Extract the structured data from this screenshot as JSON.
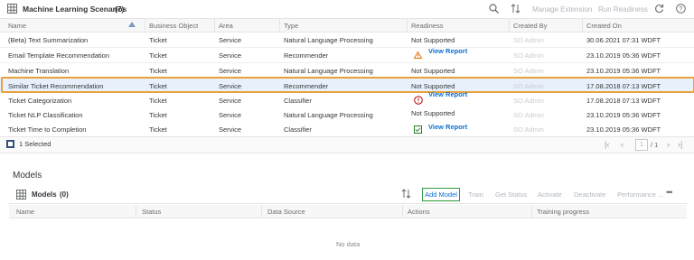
{
  "top_table": {
    "title": "Machine Learning Scenarios",
    "count": "(7)",
    "toolbar": {
      "manage_extension": "Manage Extension",
      "run_readiness": "Run Readiness"
    },
    "columns": [
      "Name",
      "Business Object",
      "Area",
      "Type",
      "Readiness",
      "Created By",
      "Created On"
    ],
    "rows": [
      {
        "name": "(Beta) Text Summarization",
        "bo": "Ticket",
        "area": "Service",
        "type": "Natural Language Processing",
        "readiness": "Not Supported",
        "created_by": "SO Admin",
        "created_on": "30.06.2021 07:31 WDFT"
      },
      {
        "name": "Email Template Recommendation",
        "bo": "Ticket",
        "area": "Service",
        "type": "Recommender",
        "readiness": "View Report",
        "created_by": "SO Admin",
        "created_on": "23.10.2019 05:36 WDFT"
      },
      {
        "name": "Machine Translation",
        "bo": "Ticket",
        "area": "Service",
        "type": "Natural Language Processing",
        "readiness": "Not Supported",
        "created_by": "SO Admin",
        "created_on": "23.10.2019 05:36 WDFT"
      },
      {
        "name": "Similar Ticket Recommendation",
        "bo": "Ticket",
        "area": "Service",
        "type": "Recommender",
        "readiness": "Not Supported",
        "created_by": "SO Admin",
        "created_on": "17.08.2018 07:13 WDFT"
      },
      {
        "name": "Ticket Categorization",
        "bo": "Ticket",
        "area": "Service",
        "type": "Classifier",
        "readiness": "View Report",
        "created_by": "SO Admin",
        "created_on": "17.08.2018 07:13 WDFT"
      },
      {
        "name": "Ticket NLP Classification",
        "bo": "Ticket",
        "area": "Service",
        "type": "Natural Language Processing",
        "readiness": "Not Supported",
        "created_by": "SO Admin",
        "created_on": "23.10.2019 05:36 WDFT"
      },
      {
        "name": "Ticket Time to Completion",
        "bo": "Ticket",
        "area": "Service",
        "type": "Classifier",
        "readiness": "View Report",
        "created_by": "SO Admin",
        "created_on": "23.10.2019 05:36 WDFT"
      }
    ],
    "footer": {
      "selected_text": "1 Selected",
      "page": "1",
      "page_total": "/ 1"
    }
  },
  "models": {
    "heading": "Models",
    "table_title": "Models",
    "count": "(0)",
    "toolbar": {
      "add_model": "Add Model",
      "train": "Train",
      "get_status": "Get Status",
      "activate": "Activate",
      "deactivate": "Deactivate",
      "performance": "Performance ..."
    },
    "columns": [
      "Name",
      "Status",
      "Data Source",
      "Actions",
      "Training progress"
    ],
    "no_data": "No data"
  },
  "colors": {
    "link": "#0a6ed1",
    "selection_outline": "#e8a13b",
    "add_model_outline": "#2e9b3d",
    "warning": "#e9730c",
    "error": "#bb0000",
    "success": "#2b7d2b"
  }
}
